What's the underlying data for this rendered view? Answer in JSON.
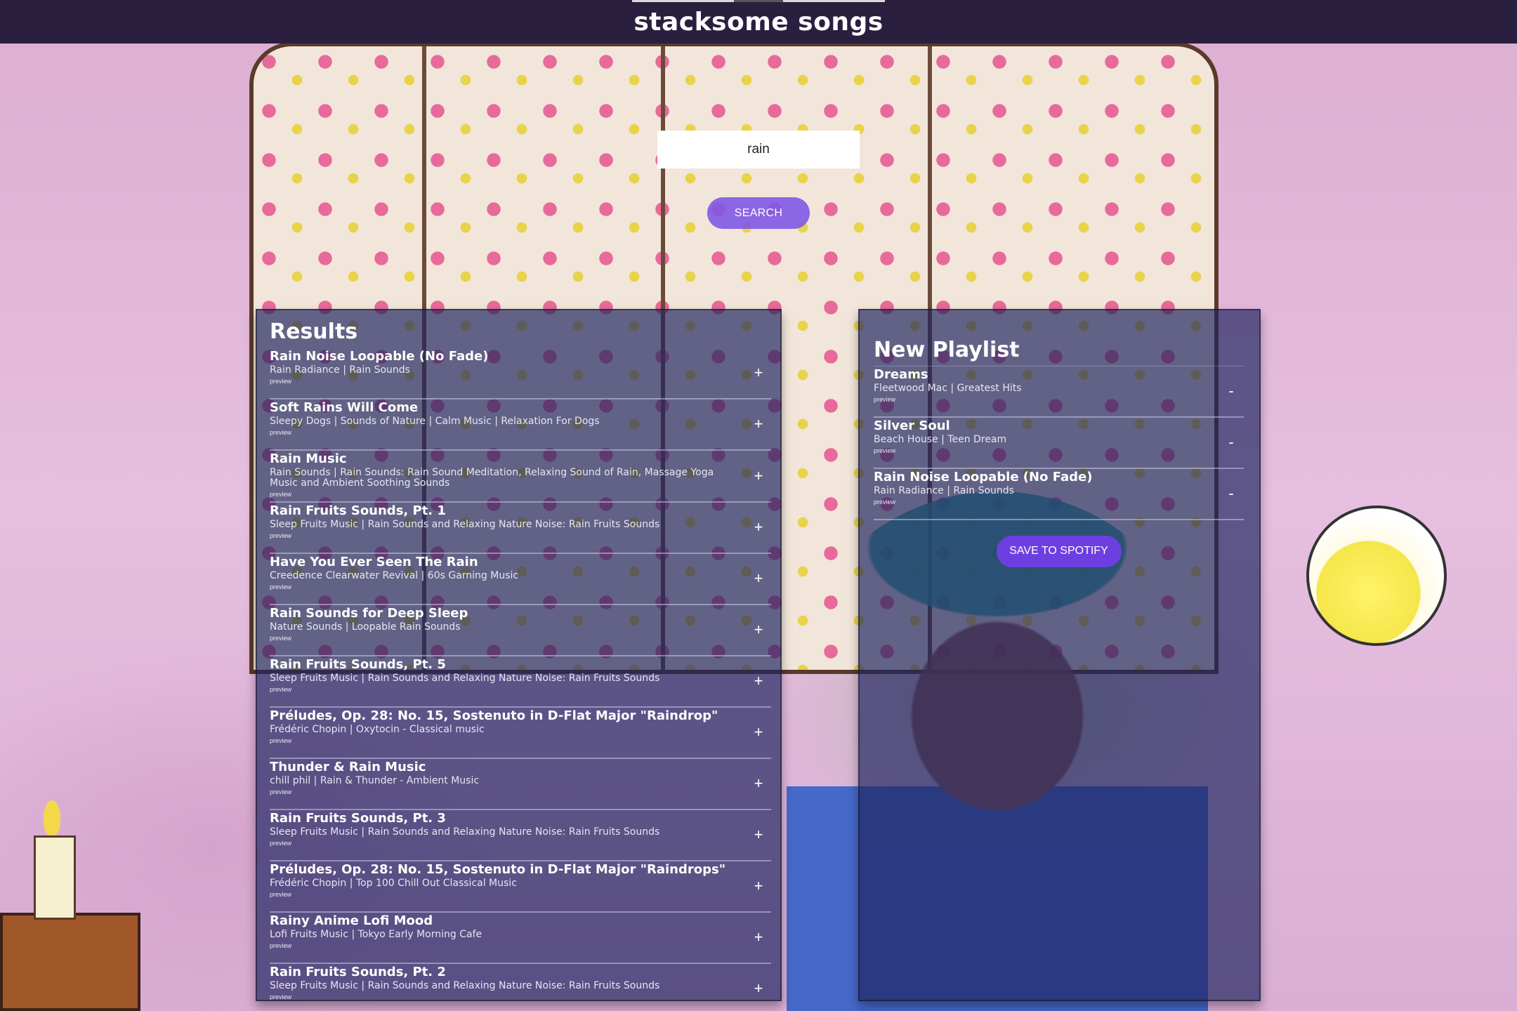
{
  "header": {
    "title": "stacksome songs"
  },
  "search": {
    "value": "rain",
    "button_label": "SEARCH"
  },
  "results": {
    "title": "Results",
    "preview_label": "preview",
    "add_label": "+",
    "tracks": [
      {
        "name": "Rain Noise Loopable (No Fade)",
        "info": "Rain Radiance | Rain Sounds"
      },
      {
        "name": "Soft Rains Will Come",
        "info": "Sleepy Dogs | Sounds of Nature | Calm Music | Relaxation For Dogs"
      },
      {
        "name": "Rain Music",
        "info": "Rain Sounds | Rain Sounds: Rain Sound Meditation, Relaxing Sound of Rain, Massage Yoga Music and Ambient Soothing Sounds"
      },
      {
        "name": "Rain Fruits Sounds, Pt. 1",
        "info": "Sleep Fruits Music | Rain Sounds and Relaxing Nature Noise: Rain Fruits Sounds"
      },
      {
        "name": "Have You Ever Seen The Rain",
        "info": "Creedence Clearwater Revival | 60s Garning Music"
      },
      {
        "name": "Rain Sounds for Deep Sleep",
        "info": "Nature Sounds | Loopable Rain Sounds"
      },
      {
        "name": "Rain Fruits Sounds, Pt. 5",
        "info": "Sleep Fruits Music | Rain Sounds and Relaxing Nature Noise: Rain Fruits Sounds"
      },
      {
        "name": "Préludes, Op. 28: No. 15, Sostenuto in D-Flat Major \"Raindrop\"",
        "info": "Frédéric Chopin | Oxytocin - Classical music"
      },
      {
        "name": "Thunder & Rain Music",
        "info": "chill phil | Rain & Thunder - Ambient Music"
      },
      {
        "name": "Rain Fruits Sounds, Pt. 3",
        "info": "Sleep Fruits Music | Rain Sounds and Relaxing Nature Noise: Rain Fruits Sounds"
      },
      {
        "name": "Préludes, Op. 28: No. 15, Sostenuto in D-Flat Major \"Raindrops\"",
        "info": "Frédéric Chopin | Top 100 Chill Out Classical Music"
      },
      {
        "name": "Rainy Anime Lofi Mood",
        "info": "Lofi Fruits Music | Tokyo Early Morning Cafe"
      },
      {
        "name": "Rain Fruits Sounds, Pt. 2",
        "info": "Sleep Fruits Music | Rain Sounds and Relaxing Nature Noise: Rain Fruits Sounds"
      }
    ]
  },
  "playlist": {
    "title": "New Playlist",
    "preview_label": "preview",
    "remove_label": "-",
    "save_label": "SAVE TO SPOTIFY",
    "tracks": [
      {
        "name": "Dreams",
        "info": "Fleetwood Mac | Greatest Hits"
      },
      {
        "name": "Silver Soul",
        "info": "Beach House | Teen Dream"
      },
      {
        "name": "Rain Noise Loopable (No Fade)",
        "info": "Rain Radiance | Rain Sounds"
      }
    ]
  }
}
